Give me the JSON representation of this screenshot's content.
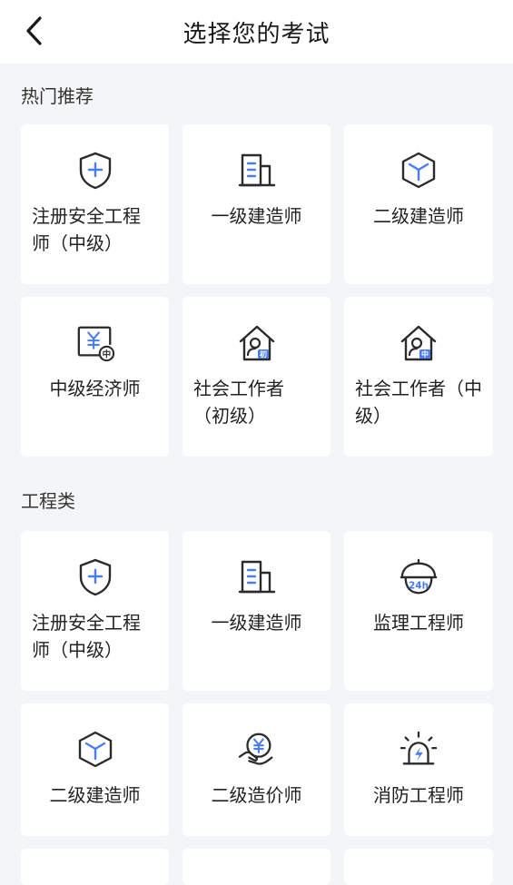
{
  "header": {
    "title": "选择您的考试",
    "back_icon": "chevron-left-icon"
  },
  "colors": {
    "accent": "#4a7cf6",
    "stroke": "#2b2b2b",
    "background": "#f4f5f7",
    "card": "#ffffff"
  },
  "sections": [
    {
      "title": "热门推荐",
      "items": [
        {
          "label": "注册安全工程师（中级）",
          "icon": "shield-plus-icon"
        },
        {
          "label": "一级建造师",
          "icon": "building-icon"
        },
        {
          "label": "二级建造师",
          "icon": "cube-icon"
        },
        {
          "label": "中级经济师",
          "icon": "yuan-screen-icon",
          "badge": "中"
        },
        {
          "label": "社会工作者（初级）",
          "icon": "house-person-icon",
          "badge": "初"
        },
        {
          "label": "社会工作者（中级）",
          "icon": "house-person-icon",
          "badge": "中"
        }
      ]
    },
    {
      "title": "工程类",
      "items": [
        {
          "label": "注册安全工程师（中级）",
          "icon": "shield-plus-icon"
        },
        {
          "label": "一级建造师",
          "icon": "building-icon"
        },
        {
          "label": "监理工程师",
          "icon": "helmet-24h-icon",
          "badge": "24h"
        },
        {
          "label": "二级建造师",
          "icon": "cube-icon"
        },
        {
          "label": "二级造价师",
          "icon": "hand-coin-icon"
        },
        {
          "label": "消防工程师",
          "icon": "alarm-light-icon"
        }
      ]
    }
  ]
}
